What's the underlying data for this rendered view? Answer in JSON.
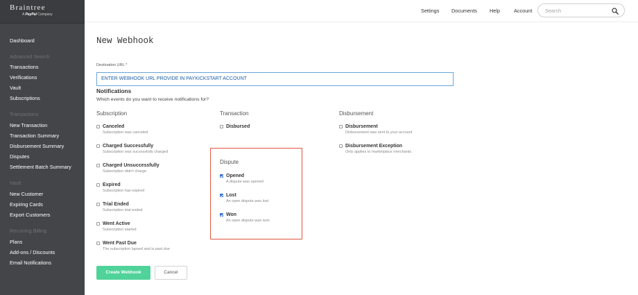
{
  "brand": {
    "name": "Braintree",
    "sub_prefix": "A",
    "sub_company": "PayPal",
    "sub_suffix": "Company"
  },
  "sidebar": {
    "items": [
      {
        "label": "Dashboard",
        "kind": "item"
      },
      {
        "label": "Advanced Search",
        "kind": "head"
      },
      {
        "label": "Transactions",
        "kind": "item"
      },
      {
        "label": "Verifications",
        "kind": "item"
      },
      {
        "label": "Vault",
        "kind": "item"
      },
      {
        "label": "Subscriptions",
        "kind": "item"
      },
      {
        "label": "Transactions",
        "kind": "head"
      },
      {
        "label": "New Transaction",
        "kind": "item"
      },
      {
        "label": "Transaction Summary",
        "kind": "item"
      },
      {
        "label": "Disbursement Summary",
        "kind": "item"
      },
      {
        "label": "Disputes",
        "kind": "item"
      },
      {
        "label": "Settlement Batch Summary",
        "kind": "item"
      },
      {
        "label": "Vault",
        "kind": "head"
      },
      {
        "label": "New Customer",
        "kind": "item"
      },
      {
        "label": "Expiring Cards",
        "kind": "item"
      },
      {
        "label": "Export Customers",
        "kind": "item"
      },
      {
        "label": "Recurring Billing",
        "kind": "head"
      },
      {
        "label": "Plans",
        "kind": "item"
      },
      {
        "label": "Add-ons / Discounts",
        "kind": "item"
      },
      {
        "label": "Email Notifications",
        "kind": "item"
      }
    ]
  },
  "topnav": {
    "settings": "Settings",
    "documents": "Documents",
    "help": "Help",
    "account": "Account",
    "search_placeholder": "Search",
    "search_icon": "magnifier-icon"
  },
  "page": {
    "title": "New Webhook",
    "url_label": "Destination URL *",
    "url_value": "ENTER WEBHOOK URL PROVIDE IN PAYKICKSTART ACCOUNT",
    "notifications_title": "Notifications",
    "notifications_desc": "Which events do you want to receive notifications for?"
  },
  "columns": {
    "subscription": "Subscription",
    "transaction": "Transaction",
    "disbursement": "Disbursement",
    "dispute": "Dispute"
  },
  "subscription_options": [
    {
      "name": "Canceled",
      "desc": "Subscription was canceled",
      "checked": false
    },
    {
      "name": "Charged Successfully",
      "desc": "Subscription was successfully charged",
      "checked": false
    },
    {
      "name": "Charged Unsuccessfully",
      "desc": "Subscription didn't charge",
      "checked": false
    },
    {
      "name": "Expired",
      "desc": "Subscription has expired",
      "checked": false
    },
    {
      "name": "Trial Ended",
      "desc": "Subscription trial ended",
      "checked": false
    },
    {
      "name": "Went Active",
      "desc": "Subscription started",
      "checked": false
    },
    {
      "name": "Went Past Due",
      "desc": "The subscription lapsed and is past due",
      "checked": false
    }
  ],
  "transaction_options": [
    {
      "name": "Disbursed",
      "desc": "",
      "checked": false
    }
  ],
  "disbursement_options": [
    {
      "name": "Disbursement",
      "desc": "Disbursement was sent to your account",
      "checked": false
    },
    {
      "name": "Disbursement Exception",
      "desc": "Only applies to marketplace merchants",
      "checked": false
    }
  ],
  "dispute_options": [
    {
      "name": "Opened",
      "desc": "A dispute was opened",
      "checked": true
    },
    {
      "name": "Lost",
      "desc": "An open dispute was lost",
      "checked": true
    },
    {
      "name": "Won",
      "desc": "An open dispute was won",
      "checked": true
    }
  ],
  "actions": {
    "create": "Create Webhook",
    "cancel": "Cancel"
  },
  "colors": {
    "sidebar": "#434548",
    "accent_green": "#4fd39a",
    "highlight_border": "#e2523a",
    "checkbox_checked": "#2f6fd6",
    "url_border": "#6aa3d8"
  }
}
